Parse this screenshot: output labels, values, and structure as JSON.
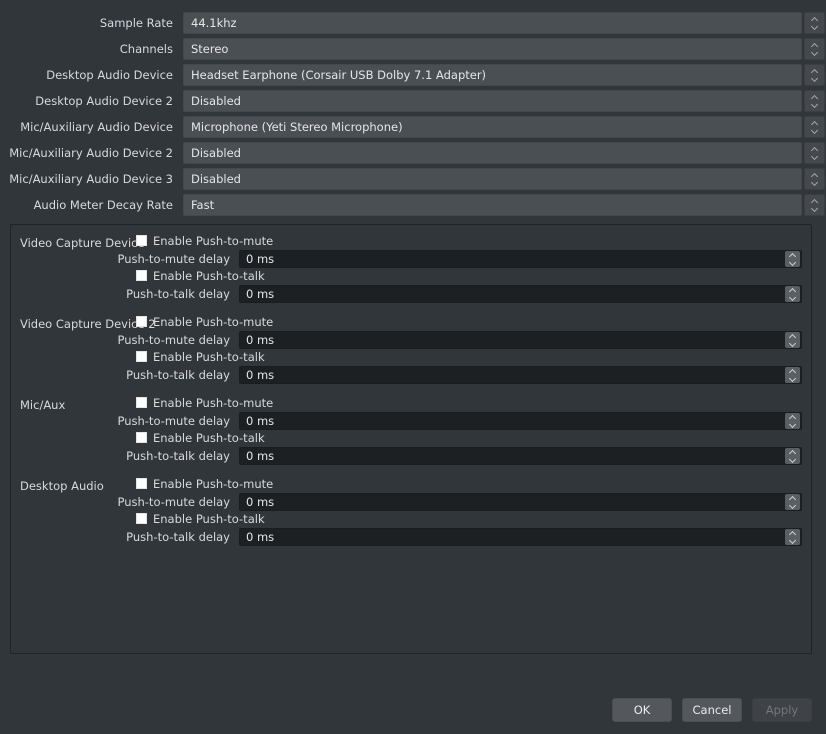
{
  "device_settings": {
    "rows": [
      {
        "label": "Sample Rate",
        "value": "44.1khz",
        "icon": "chevron-updown-icon"
      },
      {
        "label": "Channels",
        "value": "Stereo",
        "icon": "chevron-updown-icon"
      },
      {
        "label": "Desktop Audio Device",
        "value": "Headset Earphone (Corsair USB Dolby 7.1 Adapter)",
        "icon": "chevron-updown-icon"
      },
      {
        "label": "Desktop Audio Device 2",
        "value": "Disabled",
        "icon": "chevron-updown-icon"
      },
      {
        "label": "Mic/Auxiliary Audio Device",
        "value": "Microphone (Yeti Stereo Microphone)",
        "icon": "chevron-updown-icon"
      },
      {
        "label": "Mic/Auxiliary Audio Device 2",
        "value": "Disabled",
        "icon": "chevron-updown-icon"
      },
      {
        "label": "Mic/Auxiliary Audio Device 3",
        "value": "Disabled",
        "icon": "chevron-updown-icon"
      },
      {
        "label": "Audio Meter Decay Rate",
        "value": "Fast",
        "icon": "chevron-updown-icon"
      }
    ]
  },
  "push_to_talk": {
    "groups": [
      {
        "source": "Video Capture Device",
        "push_to_mute_label": "Enable Push-to-mute",
        "push_to_mute_checked": false,
        "push_to_mute_delay_label": "Push-to-mute delay",
        "push_to_mute_delay_value": "0 ms",
        "push_to_talk_label": "Enable Push-to-talk",
        "push_to_talk_checked": false,
        "push_to_talk_delay_label": "Push-to-talk delay",
        "push_to_talk_delay_value": "0 ms"
      },
      {
        "source": "Video Capture Device 2",
        "push_to_mute_label": "Enable Push-to-mute",
        "push_to_mute_checked": false,
        "push_to_mute_delay_label": "Push-to-mute delay",
        "push_to_mute_delay_value": "0 ms",
        "push_to_talk_label": "Enable Push-to-talk",
        "push_to_talk_checked": false,
        "push_to_talk_delay_label": "Push-to-talk delay",
        "push_to_talk_delay_value": "0 ms"
      },
      {
        "source": "Mic/Aux",
        "push_to_mute_label": "Enable Push-to-mute",
        "push_to_mute_checked": false,
        "push_to_mute_delay_label": "Push-to-mute delay",
        "push_to_mute_delay_value": "0 ms",
        "push_to_talk_label": "Enable Push-to-talk",
        "push_to_talk_checked": false,
        "push_to_talk_delay_label": "Push-to-talk delay",
        "push_to_talk_delay_value": "0 ms"
      },
      {
        "source": "Desktop Audio",
        "push_to_mute_label": "Enable Push-to-mute",
        "push_to_mute_checked": false,
        "push_to_mute_delay_label": "Push-to-mute delay",
        "push_to_mute_delay_value": "0 ms",
        "push_to_talk_label": "Enable Push-to-talk",
        "push_to_talk_checked": false,
        "push_to_talk_delay_label": "Push-to-talk delay",
        "push_to_talk_delay_value": "0 ms"
      }
    ]
  },
  "buttons": {
    "ok": "OK",
    "cancel": "Cancel",
    "apply": "Apply",
    "apply_enabled": false
  },
  "colors": {
    "background": "#31363b",
    "combo_background": "#4a4f54",
    "spinbox_background": "#1d2023",
    "text": "#d9d9d9",
    "panel_border": "#1f2326",
    "button_background": "#54585c"
  }
}
